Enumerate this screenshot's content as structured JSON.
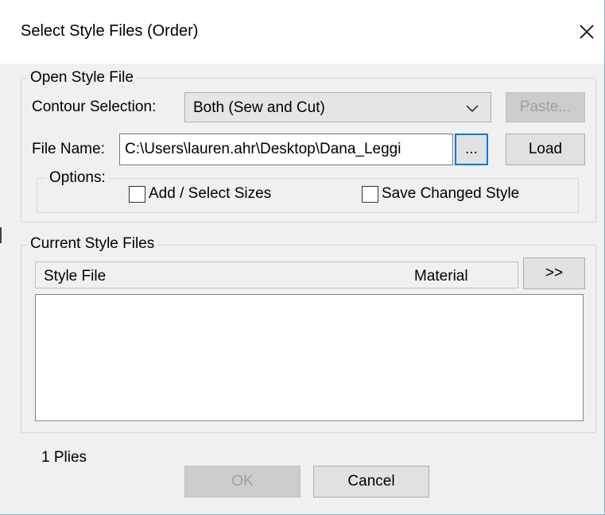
{
  "dialog": {
    "title": "Select Style Files (Order)"
  },
  "open_style_file": {
    "group_label": "Open Style File",
    "contour_label": "Contour Selection:",
    "contour_value": "Both (Sew and Cut)",
    "paste_label": "Paste...",
    "filename_label": "File Name:",
    "filename_value": "C:\\Users\\lauren.ahr\\Desktop\\Dana_Leggi",
    "browse_label": "...",
    "load_label": "Load",
    "options_label": "Options:",
    "add_sizes_label": "Add / Select Sizes",
    "save_changed_label": "Save Changed Style"
  },
  "current_style_files": {
    "group_label": "Current Style Files",
    "columns": [
      "Style File",
      "Material"
    ],
    "expand_label": ">>"
  },
  "footer": {
    "plies": "1 Plies",
    "ok_label": "OK",
    "cancel_label": "Cancel"
  }
}
